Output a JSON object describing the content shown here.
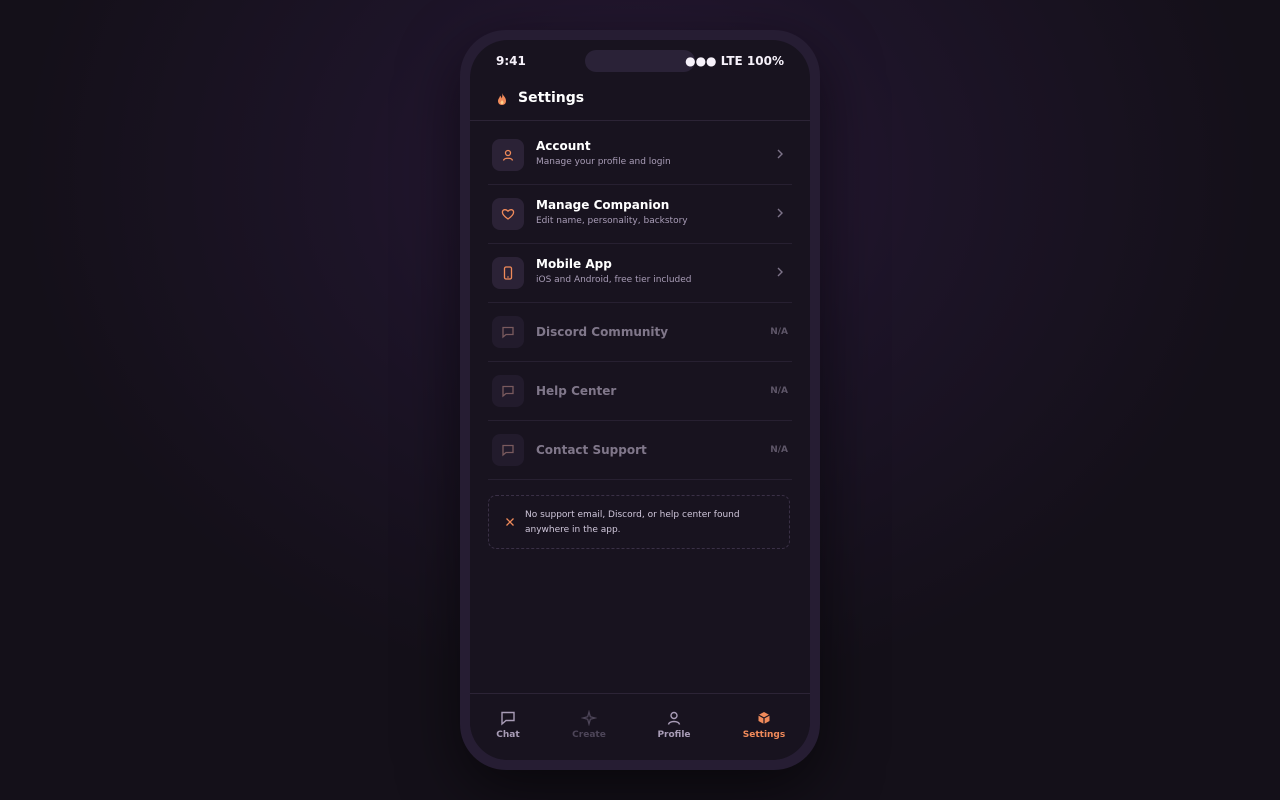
{
  "colors": {
    "accent": "#f08a5a",
    "background": "#18131f",
    "frame": "#261d33"
  },
  "status_bar": {
    "time": "9:41",
    "right": "●●● LTE 100%"
  },
  "header": {
    "title": "Settings",
    "logo_icon": "flame-icon"
  },
  "settings": [
    {
      "icon": "user-icon",
      "title": "Account",
      "subtitle": "Manage your profile and login",
      "trailing": "chevron-right-icon"
    },
    {
      "icon": "heart-icon",
      "title": "Manage Companion",
      "subtitle": "Edit name, personality, backstory",
      "trailing": "chevron-right-icon"
    },
    {
      "icon": "smartphone-icon",
      "title": "Mobile App",
      "subtitle": "iOS and Android, free tier included",
      "trailing": "chevron-right-icon"
    },
    {
      "icon": "message-square-icon",
      "title": "Discord Community",
      "badge": "N/A"
    },
    {
      "icon": "message-square-icon",
      "title": "Help Center",
      "badge": "N/A"
    },
    {
      "icon": "message-square-icon",
      "title": "Contact Support",
      "badge": "N/A"
    }
  ],
  "notice": {
    "icon": "x-icon",
    "text": "No support email, Discord, or help center found anywhere in the app."
  },
  "tabs": [
    {
      "label": "Chat",
      "icon": "chat-icon"
    },
    {
      "label": "Create",
      "icon": "sparkle-icon"
    },
    {
      "label": "Profile",
      "icon": "user-icon"
    },
    {
      "label": "Settings",
      "icon": "cube-icon"
    }
  ]
}
